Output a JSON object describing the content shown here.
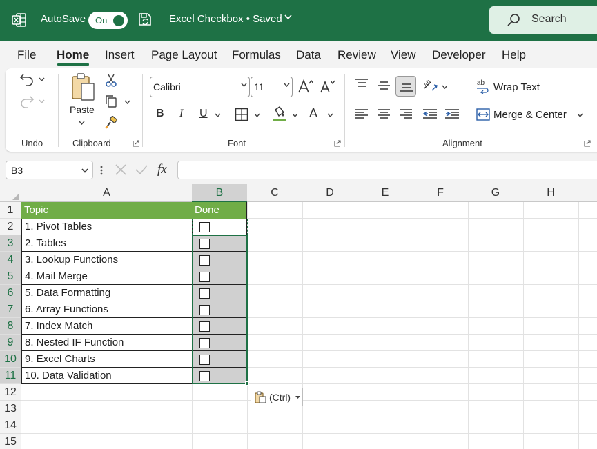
{
  "titlebar": {
    "autosave_label": "AutoSave",
    "toggle_state": "On",
    "document_title": "Excel Checkbox • Saved",
    "search_placeholder": "Search"
  },
  "tabs": [
    "File",
    "Home",
    "Insert",
    "Page Layout",
    "Formulas",
    "Data",
    "Review",
    "View",
    "Developer",
    "Help"
  ],
  "active_tab": "Home",
  "ribbon": {
    "undo_group": "Undo",
    "clipboard_group": "Clipboard",
    "paste_label": "Paste",
    "font_group": "Font",
    "font_name": "Calibri",
    "font_size": "11",
    "bold": "B",
    "italic": "I",
    "underline": "U",
    "font_color_glyph": "A",
    "alignment_group": "Alignment",
    "wrap_text": "Wrap Text",
    "merge_center": "Merge & Center"
  },
  "formula_bar": {
    "name_box": "B3",
    "fx": "fx",
    "formula": ""
  },
  "grid": {
    "columns": [
      "A",
      "B",
      "C",
      "D",
      "E",
      "F",
      "G",
      "H"
    ],
    "rows": [
      "1",
      "2",
      "3",
      "4",
      "5",
      "6",
      "7",
      "8",
      "9",
      "10",
      "11",
      "12",
      "13",
      "14",
      "15"
    ],
    "selected_column": "B",
    "selected_rows": [
      "3",
      "4",
      "5",
      "6",
      "7",
      "8",
      "9",
      "10",
      "11"
    ],
    "table_header": [
      "Topic",
      "Done"
    ],
    "topics": [
      "1. Pivot Tables",
      "2. Tables",
      "3. Lookup Functions",
      "4. Mail Merge",
      "5. Data Formatting",
      "6. Array Functions",
      "7. Index Match",
      "8. Nested IF Function",
      "9. Excel Charts",
      "10. Data Validation"
    ],
    "checked": [
      false,
      false,
      false,
      false,
      false,
      false,
      false,
      false,
      false,
      false
    ]
  },
  "paste_options": {
    "label": "(Ctrl)"
  },
  "colors": {
    "excel_green": "#1e7145",
    "table_header_green": "#70ad47",
    "selection_shade": "#d0d0d0"
  }
}
